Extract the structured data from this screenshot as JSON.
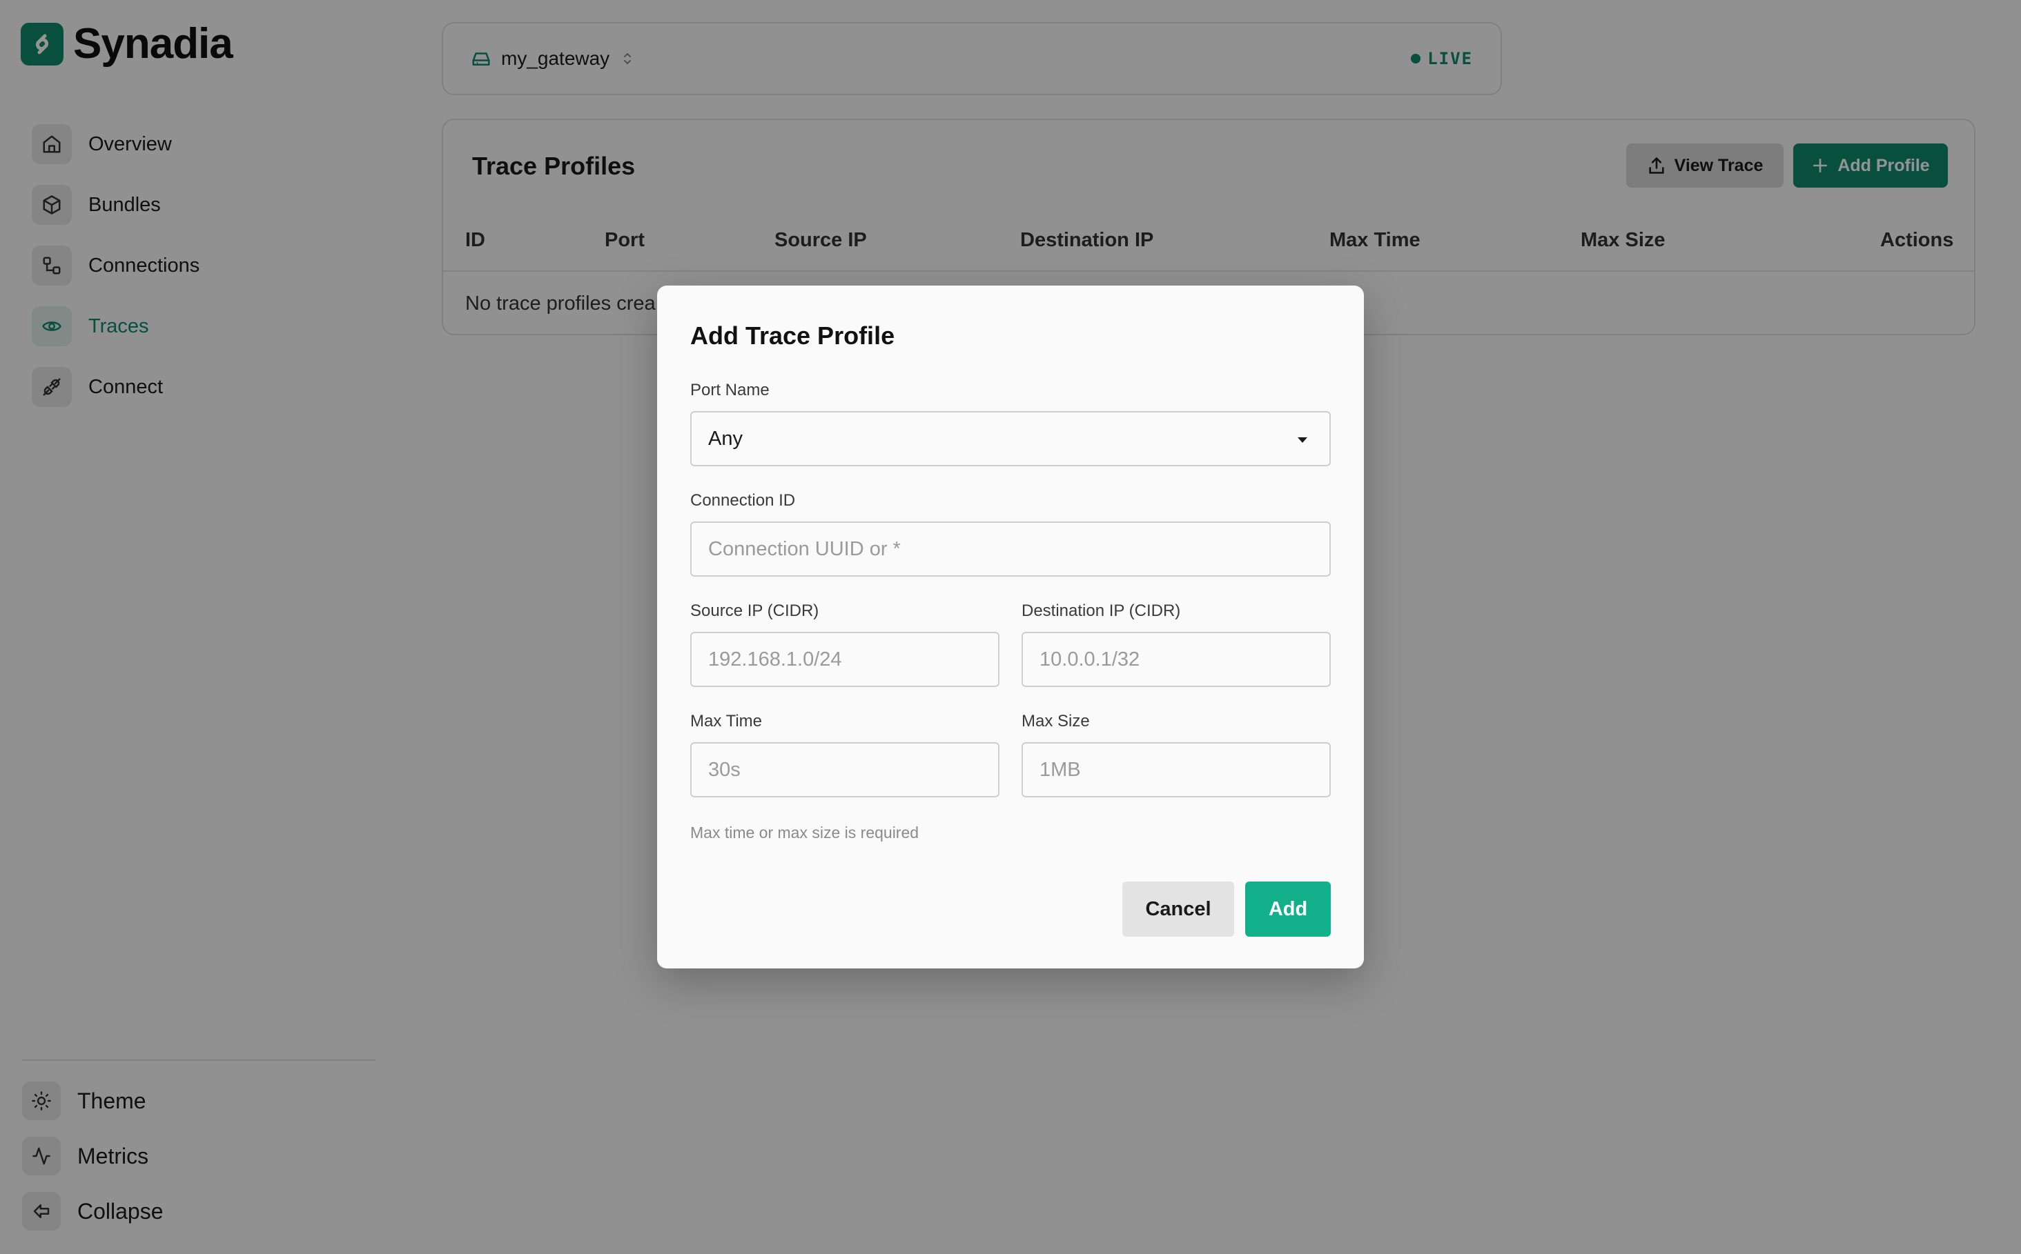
{
  "brand": {
    "name": "Synadia",
    "logo_icon": "synadia-logo-icon",
    "accent": "#0f8a6a"
  },
  "sidebar": {
    "items": [
      {
        "label": "Overview",
        "icon": "home-icon"
      },
      {
        "label": "Bundles",
        "icon": "package-icon"
      },
      {
        "label": "Connections",
        "icon": "connections-icon"
      },
      {
        "label": "Traces",
        "icon": "eye-icon",
        "active": true
      },
      {
        "label": "Connect",
        "icon": "plug-icon"
      }
    ],
    "bottom": [
      {
        "label": "Theme",
        "icon": "sun-icon"
      },
      {
        "label": "Metrics",
        "icon": "activity-icon"
      },
      {
        "label": "Collapse",
        "icon": "collapse-icon"
      }
    ]
  },
  "gateway": {
    "name": "my_gateway",
    "status": "LIVE",
    "status_color": "#0f8a6a"
  },
  "panel": {
    "title": "Trace Profiles",
    "view_trace_label": "View Trace",
    "add_profile_label": "Add Profile",
    "columns": [
      "ID",
      "Port",
      "Source IP",
      "Destination IP",
      "Max Time",
      "Max Size",
      "Actions"
    ],
    "empty_message": "No trace profiles crea"
  },
  "modal": {
    "title": "Add Trace Profile",
    "port_name": {
      "label": "Port Name",
      "value": "Any"
    },
    "connection_id": {
      "label": "Connection ID",
      "placeholder": "Connection UUID or *"
    },
    "source_ip": {
      "label": "Source IP (CIDR)",
      "placeholder": "192.168.1.0/24"
    },
    "destination_ip": {
      "label": "Destination IP (CIDR)",
      "placeholder": "10.0.0.1/32"
    },
    "max_time": {
      "label": "Max Time",
      "placeholder": "30s"
    },
    "max_size": {
      "label": "Max Size",
      "placeholder": "1MB"
    },
    "helper_text": "Max time or max size is required",
    "cancel_label": "Cancel",
    "add_label": "Add",
    "add_color": "#12b08a"
  }
}
